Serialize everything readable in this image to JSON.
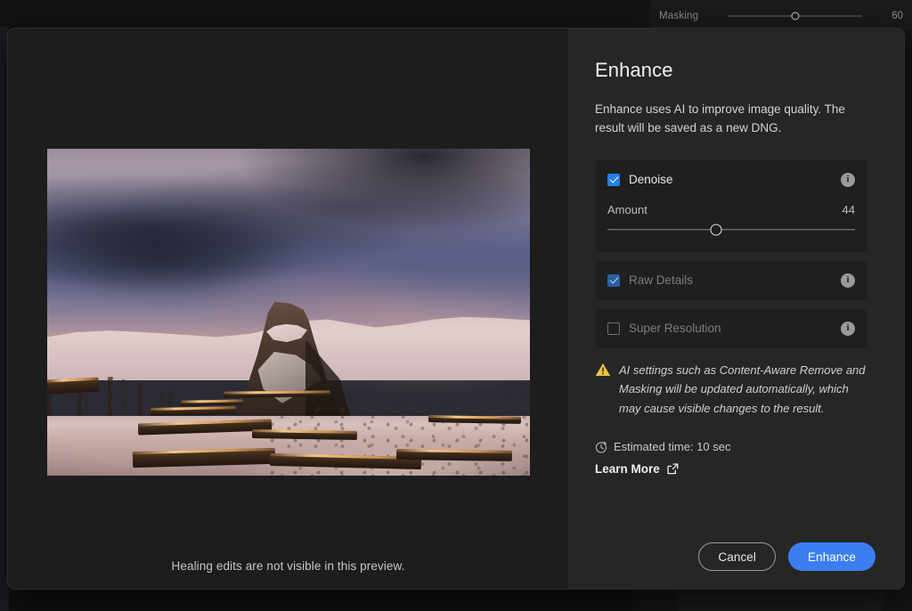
{
  "background": {
    "masking": {
      "label": "Masking",
      "value": "60",
      "slider_percent": 50
    }
  },
  "dialog": {
    "preview": {
      "caption": "Healing edits are not visible in this preview.",
      "image_description": "Snow-covered mountain peak at sunset with pink and violet clouds"
    },
    "panel": {
      "title": "Enhance",
      "description": "Enhance uses AI to improve image quality. The result will be saved as a new DNG.",
      "options": [
        {
          "id": "denoise",
          "label": "Denoise",
          "checked": true,
          "enabled": true,
          "info_icon": "info-icon",
          "slider": {
            "label": "Amount",
            "value": "44",
            "percent": 44
          }
        },
        {
          "id": "raw-details",
          "label": "Raw Details",
          "checked": true,
          "enabled": false,
          "info_icon": "info-icon"
        },
        {
          "id": "super-resolution",
          "label": "Super Resolution",
          "checked": false,
          "enabled": false,
          "info_icon": "info-icon"
        }
      ],
      "warning": {
        "icon": "warning-triangle-icon",
        "text": "AI settings such as Content-Aware Remove and Masking will be updated automatically, which may cause visible changes to the result."
      },
      "estimated_time": {
        "icon": "clock-icon",
        "text": "Estimated time: 10 sec"
      },
      "learn_more": {
        "label": "Learn More",
        "icon": "external-link-icon"
      },
      "buttons": {
        "cancel": "Cancel",
        "enhance": "Enhance"
      }
    }
  },
  "colors": {
    "accent_blue": "#3c7ef0",
    "checkbox_blue": "#2680eb",
    "panel_bg": "#262626",
    "card_bg": "#1f1f1f",
    "preview_bg": "#1d1d1d",
    "warning_amber": "#e8c44a"
  }
}
